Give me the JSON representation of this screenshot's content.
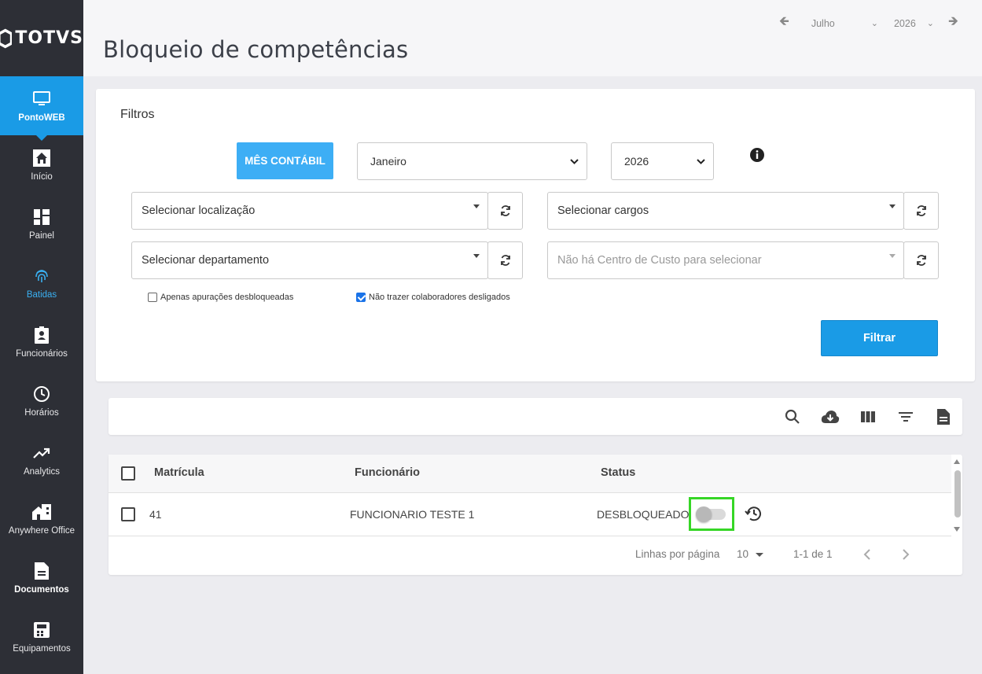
{
  "sidebar": {
    "logo": "TOTVS",
    "items": [
      {
        "label": "PontoWEB",
        "icon": "monitor-icon"
      },
      {
        "label": "Início",
        "icon": "home-icon"
      },
      {
        "label": "Painel",
        "icon": "dashboard-icon"
      },
      {
        "label": "Batidas",
        "icon": "fingerprint-icon"
      },
      {
        "label": "Funcionários",
        "icon": "badge-icon"
      },
      {
        "label": "Horários",
        "icon": "clock-icon"
      },
      {
        "label": "Analytics",
        "icon": "trending-up-icon"
      },
      {
        "label": "Anywhere Office",
        "icon": "home-work-icon"
      },
      {
        "label": "Documentos",
        "icon": "document-icon"
      },
      {
        "label": "Equipamentos",
        "icon": "devices-icon"
      }
    ]
  },
  "header": {
    "title": "Bloqueio de competências",
    "month": "Julho",
    "year": "2026"
  },
  "filters": {
    "title": "Filtros",
    "mes_contabil_label": "MÊS CONTÁBIL",
    "month_value": "Janeiro",
    "year_value": "2026",
    "localizacao": "Selecionar localização",
    "cargos": "Selecionar cargos",
    "departamento": "Selecionar departamento",
    "centro_custo": "Não há Centro de Custo para selecionar",
    "chk_apenas": "Apenas apurações desbloqueadas",
    "chk_apenas_checked": false,
    "chk_nao_trazer": "Não trazer colaboradores desligados",
    "chk_nao_trazer_checked": true,
    "filtrar_label": "Filtrar"
  },
  "table": {
    "headers": {
      "matricula": "Matrícula",
      "funcionario": "Funcionário",
      "status": "Status"
    },
    "rows": [
      {
        "matricula": "41",
        "funcionario": "FUNCIONARIO TESTE 1",
        "status": "DESBLOQUEADO",
        "locked": false
      }
    ],
    "pager": {
      "rows_per_page_label": "Linhas por página",
      "rows_per_page": "10",
      "range": "1-1 de 1"
    }
  },
  "colors": {
    "accent": "#1a9be6",
    "sidebar": "#2d2f36",
    "highlight_box": "#36d626"
  }
}
